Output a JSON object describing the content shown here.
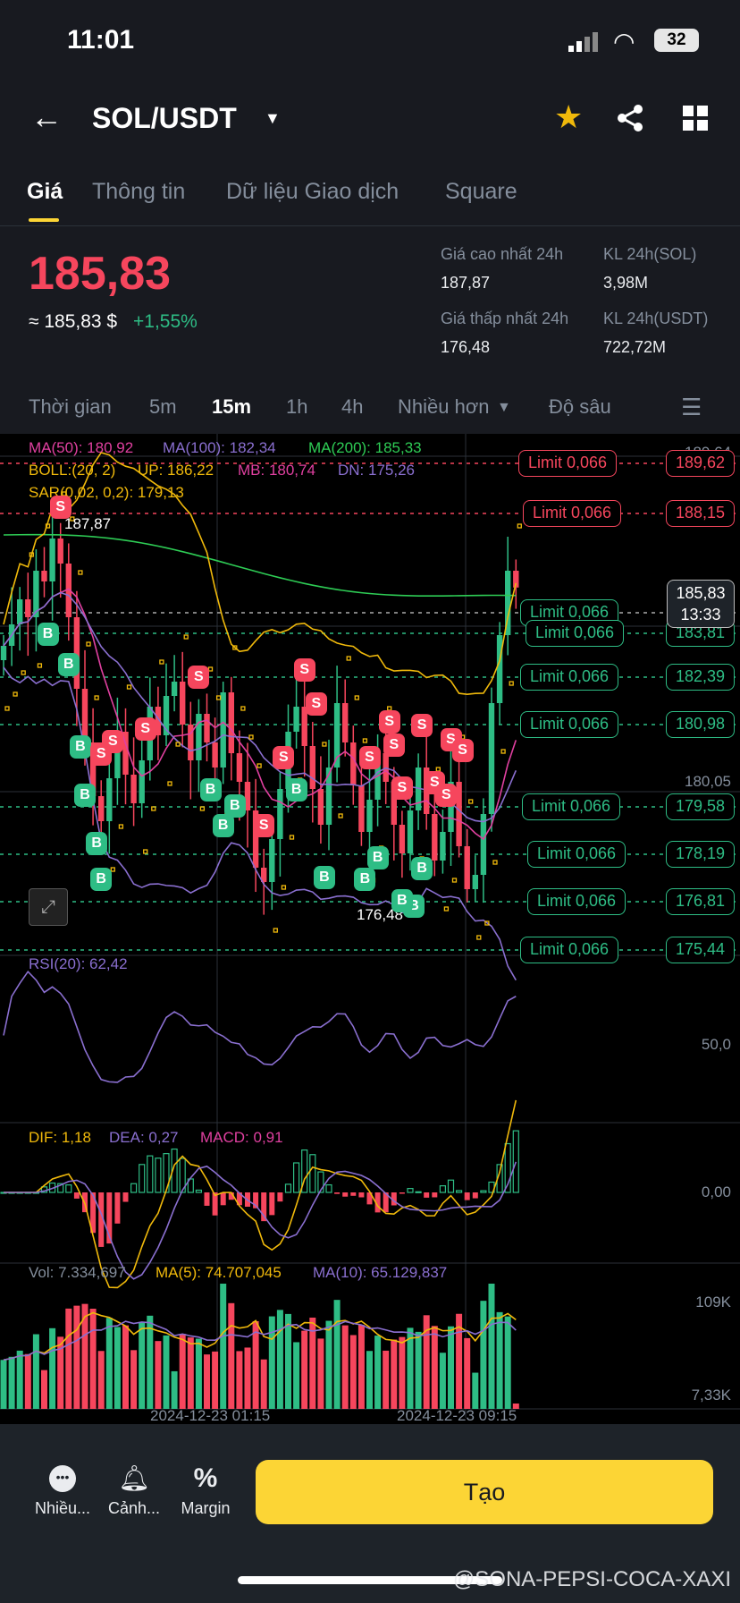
{
  "status": {
    "time": "11:01",
    "battery": "32"
  },
  "header": {
    "pair": "SOL/USDT"
  },
  "tabs": [
    "Giá",
    "Thông tin",
    "Dữ liệu Giao dịch",
    "Square"
  ],
  "ticker": {
    "last": "185,83",
    "approx": "≈ 185,83 $",
    "change": "+1,55%",
    "high_label": "Giá cao nhất 24h",
    "high": "187,87",
    "low_label": "Giá thấp nhất 24h",
    "low": "176,48",
    "vol_sol_label": "KL 24h(SOL)",
    "vol_sol": "3,98M",
    "vol_usdt_label": "KL 24h(USDT)",
    "vol_usdt": "722,72M"
  },
  "timeframes": [
    "Thời gian",
    "5m",
    "15m",
    "1h",
    "4h",
    "Nhiều hơn",
    "Độ sâu"
  ],
  "indicators": {
    "ma50": "MA(50): 180,92",
    "ma100": "MA(100): 182,34",
    "ma200": "MA(200): 185,33",
    "boll": "BOLL:(20, 2)",
    "up": "UP: 186,22",
    "mb": "MB: 180,74",
    "dn": "DN: 175,26",
    "sar": "SAR(0,02, 0,2): 179,13",
    "rsi": "RSI(20): 62,42",
    "dif": "DIF: 1,18",
    "dea": "DEA: 0,27",
    "macd": "MACD: 0,91",
    "vol": "Vol: 7.334,697",
    "vma5": "MA(5): 74.707,045",
    "vma10": "MA(10): 65.129,837"
  },
  "axis": {
    "top": "189,64",
    "mid": "180,05",
    "rsi": "50,0",
    "macd": "0,00",
    "vol_top": "109K",
    "vol_bot": "7,33K",
    "high_mark": "187,87",
    "low_mark": "176,48",
    "current": "185,83",
    "countdown": "13:33",
    "dates": [
      "2024-12-23 01:15",
      "2024-12-23 09:15"
    ]
  },
  "orders": [
    {
      "label": "Limit  0,066",
      "price": "189,62",
      "side": "sell"
    },
    {
      "label": "Limit  0,066",
      "price": "188,15",
      "side": "sell"
    },
    {
      "label": "Limit  0,066",
      "price": "185,83",
      "side": "buy"
    },
    {
      "label": "Limit  0,066",
      "price": "183,81",
      "side": "buy"
    },
    {
      "label": "Limit  0,066",
      "price": "182,39",
      "side": "buy"
    },
    {
      "label": "Limit  0,066",
      "price": "180,98",
      "side": "buy"
    },
    {
      "label": "Limit  0,066",
      "price": "179,58",
      "side": "buy"
    },
    {
      "label": "Limit  0,066",
      "price": "178,19",
      "side": "buy"
    },
    {
      "label": "Limit  0,066",
      "price": "176,81",
      "side": "buy"
    },
    {
      "label": "Limit  0,066",
      "price": "175,44",
      "side": "buy"
    }
  ],
  "markers": [
    {
      "i": 7,
      "t": "S"
    },
    {
      "i": 5,
      "t": "B"
    },
    {
      "i": 8,
      "t": "B"
    },
    {
      "i": 9,
      "t": "B"
    },
    {
      "i": 10,
      "t": "B"
    },
    {
      "i": 11,
      "t": "B"
    },
    {
      "i": 12,
      "t": "B"
    },
    {
      "i": 13,
      "t": "S"
    },
    {
      "i": 12,
      "t": "S"
    },
    {
      "i": 17,
      "t": "S"
    },
    {
      "i": 24,
      "t": "S"
    },
    {
      "i": 25,
      "t": "B"
    },
    {
      "i": 27,
      "t": "B"
    },
    {
      "i": 28,
      "t": "B"
    },
    {
      "i": 32,
      "t": "S"
    },
    {
      "i": 34,
      "t": "S"
    },
    {
      "i": 37,
      "t": "S"
    },
    {
      "i": 38,
      "t": "S"
    },
    {
      "i": 36,
      "t": "B"
    },
    {
      "i": 39,
      "t": "B"
    },
    {
      "i": 45,
      "t": "S"
    },
    {
      "i": 47,
      "t": "S"
    },
    {
      "i": 49,
      "t": "S"
    },
    {
      "i": 44,
      "t": "B"
    },
    {
      "i": 46,
      "t": "B"
    },
    {
      "i": 50,
      "t": "B"
    },
    {
      "i": 49,
      "t": "B"
    },
    {
      "i": 51,
      "t": "B"
    },
    {
      "i": 48,
      "t": "S"
    },
    {
      "i": 51,
      "t": "S"
    },
    {
      "i": 53,
      "t": "S"
    },
    {
      "i": 54,
      "t": "S"
    },
    {
      "i": 55,
      "t": "S"
    },
    {
      "i": 56,
      "t": "S"
    }
  ],
  "footer": {
    "more": "Nhiều...",
    "alert": "Cảnh...",
    "margin": "Margin",
    "create": "Tạo"
  },
  "watermark": "@SONA-PEPSI-COCA-XAXI",
  "colors": {
    "up": "#2ebd85",
    "down": "#f6465d",
    "accent": "#fcd535"
  },
  "chart_data": {
    "type": "candlestick",
    "interval": "15m",
    "closes": [
      184.2,
      184.8,
      185.5,
      185.0,
      186.3,
      186.0,
      187.2,
      186.5,
      185.0,
      183.0,
      181.5,
      180.0,
      179.3,
      180.5,
      181.8,
      180.6,
      179.8,
      181.0,
      182.5,
      181.7,
      182.8,
      183.2,
      182.0,
      181.0,
      182.3,
      181.5,
      180.8,
      182.9,
      181.2,
      180.4,
      179.6,
      178.0,
      177.6,
      178.8,
      180.2,
      181.8,
      182.5,
      181.4,
      180.2,
      179.2,
      180.8,
      182.6,
      181.5,
      180.3,
      179.0,
      179.9,
      181.2,
      180.4,
      179.2,
      178.4,
      179.6,
      180.8,
      179.5,
      178.2,
      179.0,
      180.4,
      178.6,
      177.4,
      177.8,
      179.5,
      182.6,
      184.5,
      186.3,
      185.83
    ]
  }
}
